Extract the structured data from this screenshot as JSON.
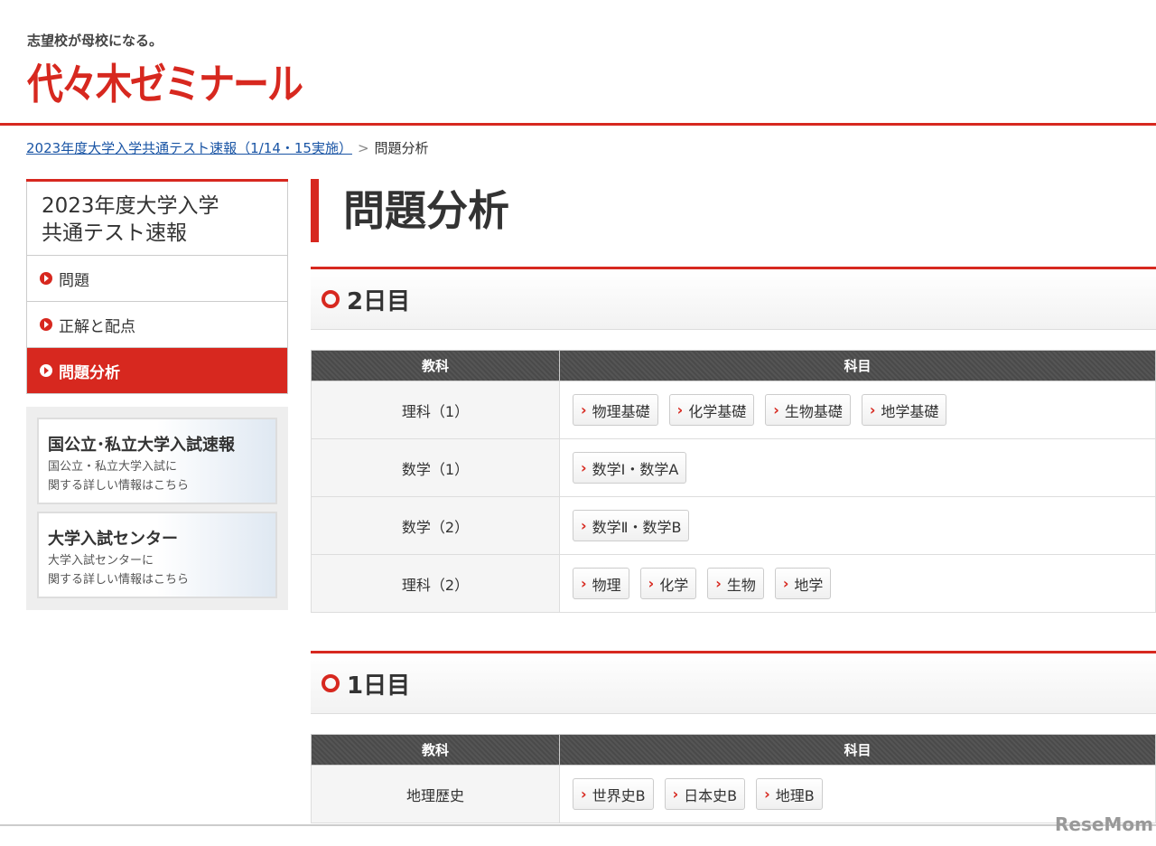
{
  "header": {
    "tagline": "志望校が母校になる。",
    "logo": "代々木ゼミナール"
  },
  "breadcrumb": {
    "parent": "2023年度大学入学共通テスト速報（1/14・15実施）",
    "separator": ">",
    "current": "問題分析"
  },
  "sidebar": {
    "title_line1": "2023年度大学入学",
    "title_line2": "共通テスト速報",
    "items": [
      {
        "label": "問題"
      },
      {
        "label": "正解と配点"
      },
      {
        "label": "問題分析",
        "active": true
      }
    ]
  },
  "banners": [
    {
      "title": "国公立･私立大学入試速報",
      "sub1": "国公立・私立大学入試に",
      "sub2": "関する詳しい情報はこちら"
    },
    {
      "title": "大学入試センター",
      "sub1": "大学入試センターに",
      "sub2": "関する詳しい情報はこちら"
    }
  ],
  "main": {
    "title": "問題分析",
    "sections": [
      {
        "heading": "2日目",
        "col1": "教科",
        "col2": "科目",
        "rows": [
          {
            "subject": "理科（1）",
            "links": [
              "物理基礎",
              "化学基礎",
              "生物基礎",
              "地学基礎"
            ]
          },
          {
            "subject": "数学（1）",
            "links": [
              "数学Ⅰ・数学A"
            ]
          },
          {
            "subject": "数学（2）",
            "links": [
              "数学Ⅱ・数学B"
            ]
          },
          {
            "subject": "理科（2）",
            "links": [
              "物理",
              "化学",
              "生物",
              "地学"
            ]
          }
        ]
      },
      {
        "heading": "1日目",
        "col1": "教科",
        "col2": "科目",
        "rows": [
          {
            "subject": "地理歴史",
            "links": [
              "世界史B",
              "日本史B",
              "地理B"
            ]
          }
        ]
      }
    ]
  },
  "watermark": "ReseMom",
  "colors": {
    "accent": "#d7281f",
    "link": "#1a55a5"
  }
}
